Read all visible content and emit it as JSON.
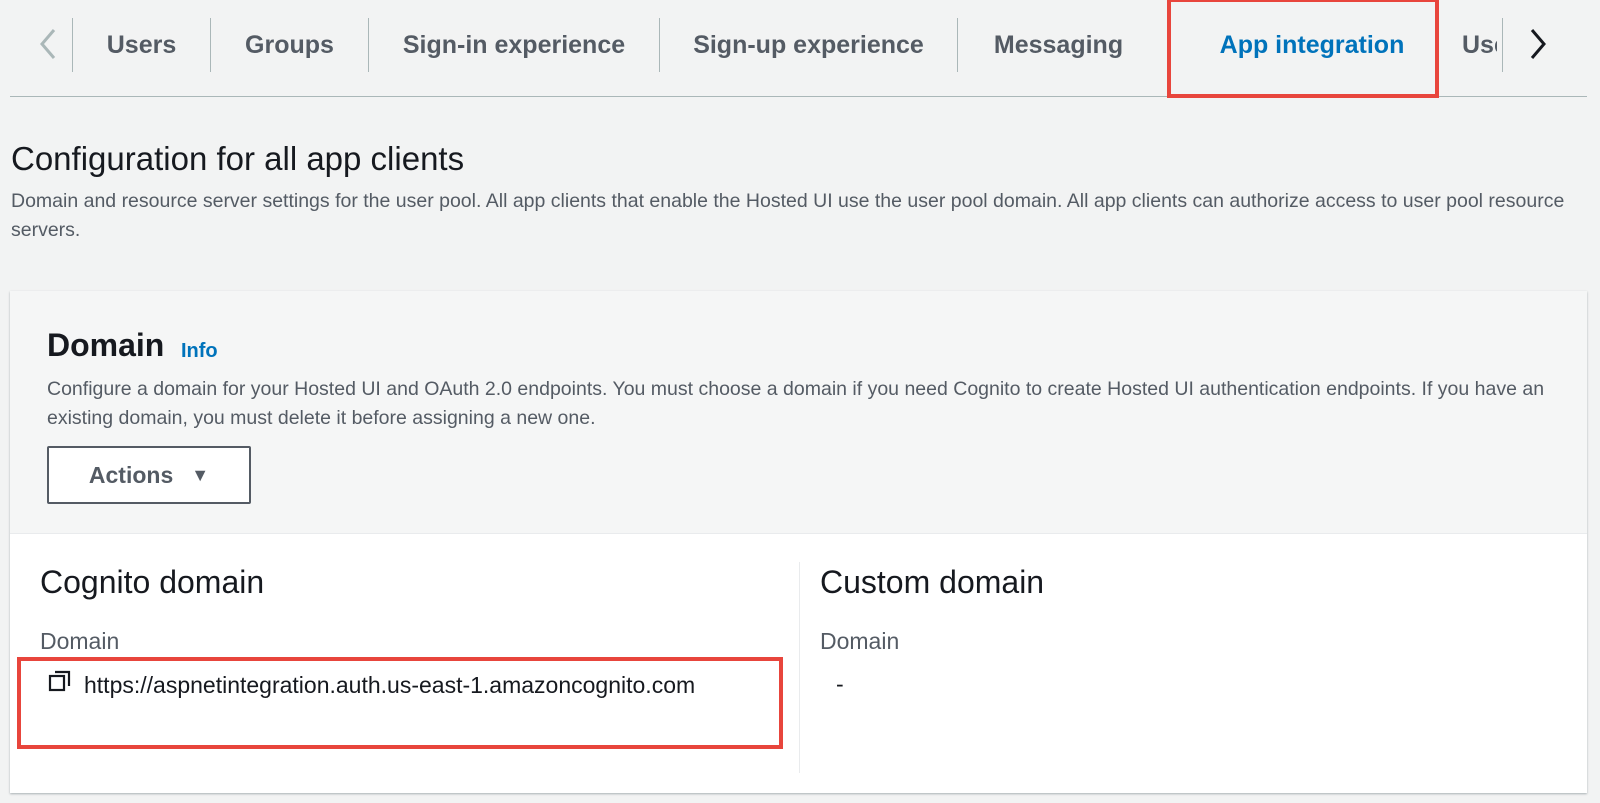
{
  "tabs": {
    "items": [
      {
        "label": "Users"
      },
      {
        "label": "Groups"
      },
      {
        "label": "Sign-in experience"
      },
      {
        "label": "Sign-up experience"
      },
      {
        "label": "Messaging"
      },
      {
        "label": "App integration"
      },
      {
        "label": "Use"
      }
    ],
    "active": "App integration",
    "prev_icon": "chevron-left-icon",
    "next_icon": "chevron-right-icon"
  },
  "section": {
    "title": "Configuration for all app clients",
    "description": "Domain and resource server settings for the user pool. All app clients that enable the Hosted UI use the user pool domain. All app clients can authorize access to user pool resource servers."
  },
  "domain_card": {
    "title": "Domain",
    "info_label": "Info",
    "description": "Configure a domain for your Hosted UI and OAuth 2.0 endpoints. You must choose a domain if you need Cognito to create Hosted UI authentication endpoints. If you have an existing domain, you must delete it before assigning a new one.",
    "actions_label": "Actions",
    "cognito_domain": {
      "title": "Cognito domain",
      "label": "Domain",
      "value": "https://aspnetintegration.auth.us-east-1.amazoncognito.com",
      "copy_icon": "copy-icon"
    },
    "custom_domain": {
      "title": "Custom domain",
      "label": "Domain",
      "value": "-"
    }
  },
  "colors": {
    "accent": "#0073bb",
    "highlight": "#e8453c",
    "background": "#f2f3f3"
  }
}
